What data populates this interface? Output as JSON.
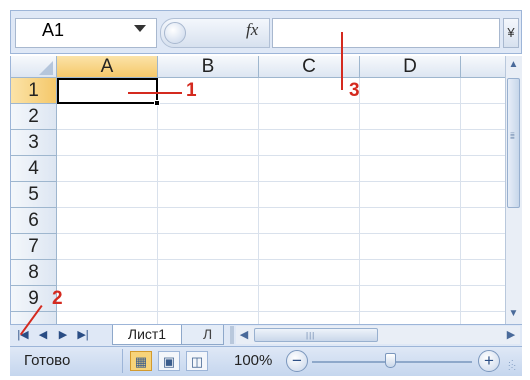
{
  "formula_bar": {
    "name_box_value": "A1",
    "fx_label": "fx"
  },
  "grid": {
    "columns": [
      "A",
      "B",
      "C",
      "D"
    ],
    "rows": [
      "1",
      "2",
      "3",
      "4",
      "5",
      "6",
      "7",
      "8",
      "9"
    ],
    "active_cell": "A1"
  },
  "sheet_tabs": {
    "tabs": [
      "Лист1",
      "Л"
    ],
    "nav_buttons": [
      "first",
      "previous",
      "next",
      "last"
    ]
  },
  "status_bar": {
    "status": "Готово",
    "zoom": "100%"
  },
  "annotations": {
    "label_1": "1",
    "label_2": "2",
    "label_3": "3",
    "color": "#d42a1f"
  },
  "colors": {
    "chrome": "#dfe8f6",
    "header": "#dde6f2",
    "selected_view": "#f7d37a"
  }
}
